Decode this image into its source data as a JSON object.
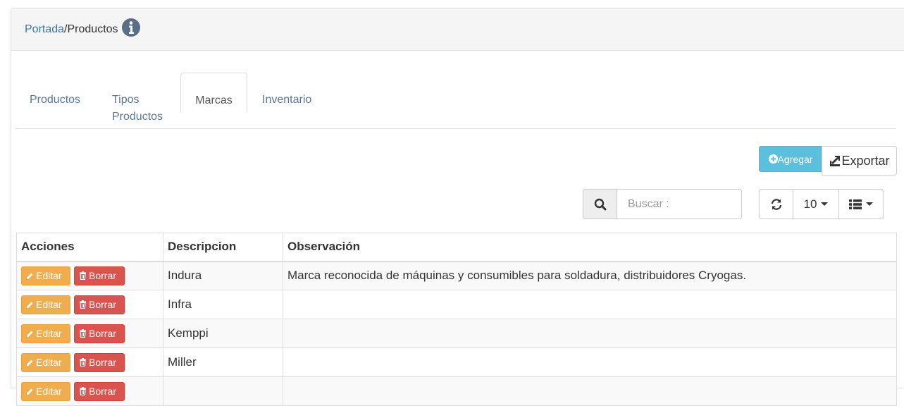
{
  "breadcrumb": {
    "home": "Portada",
    "separator": "/",
    "current": "Productos"
  },
  "tabs": [
    {
      "label": "Productos"
    },
    {
      "label": "Tipos Productos"
    },
    {
      "label": "Marcas",
      "active": true
    },
    {
      "label": "Inventario"
    }
  ],
  "toolbar": {
    "agregar_label": "Agregar",
    "exportar_label": "Exportar",
    "search_placeholder": "Buscar :",
    "page_size": "10"
  },
  "table": {
    "headers": [
      "Acciones",
      "Descripcion",
      "Observación"
    ],
    "edit_label": "Editar",
    "delete_label": "Borrar",
    "rows": [
      {
        "descripcion": "Indura",
        "observacion": "Marca reconocida de máquinas y consumibles para soldadura, distribuidores Cryogas."
      },
      {
        "descripcion": "Infra",
        "observacion": ""
      },
      {
        "descripcion": "Kemppi",
        "observacion": ""
      },
      {
        "descripcion": "Miller",
        "observacion": ""
      },
      {
        "descripcion": "",
        "observacion": ""
      }
    ]
  },
  "colors": {
    "primary_link": "#337ab7",
    "info": "#5bc0de",
    "warning": "#f0ad4e",
    "danger": "#d9534f"
  }
}
